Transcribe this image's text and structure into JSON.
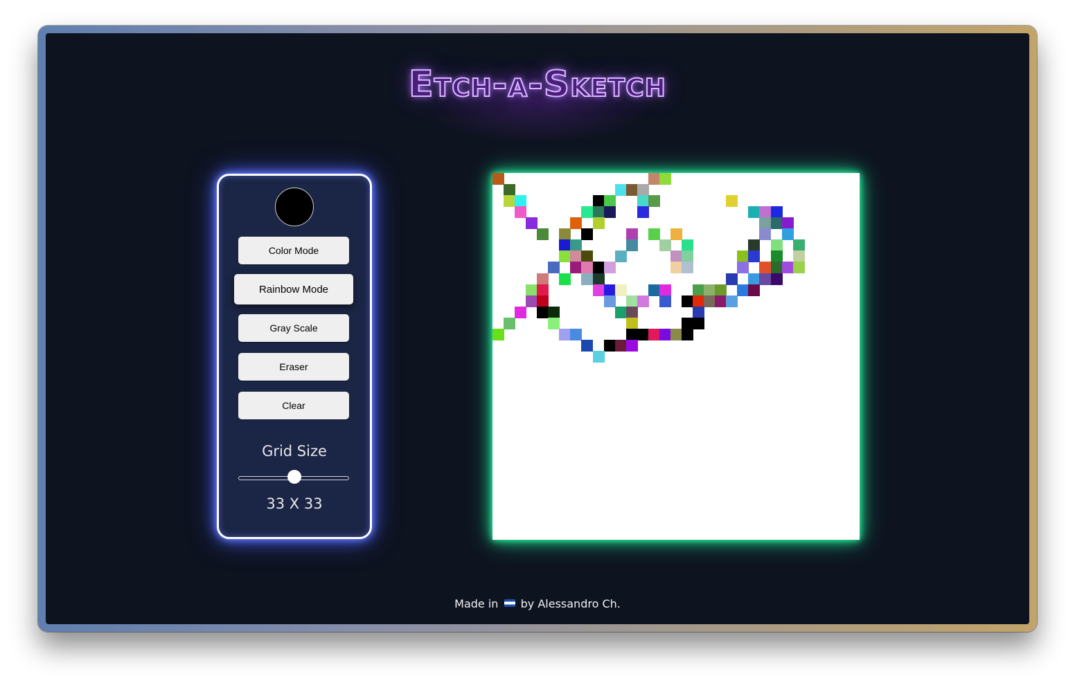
{
  "app": {
    "title": "Etch-a-Sketch",
    "footer": {
      "prefix": "Made in",
      "flag": "el-salvador-flag",
      "suffix": "by Alessandro Ch."
    }
  },
  "controls": {
    "current_color": "#000000",
    "buttons": [
      {
        "label": "Color Mode",
        "active": false
      },
      {
        "label": "Rainbow Mode",
        "active": true
      },
      {
        "label": "Gray Scale",
        "active": false
      },
      {
        "label": "Eraser",
        "active": false
      },
      {
        "label": "Clear",
        "active": false
      }
    ],
    "grid_size_label": "Grid Size",
    "grid_size": 33,
    "grid_size_min": 1,
    "grid_size_max": 64,
    "grid_size_display": "33 X 33"
  },
  "canvas": {
    "columns": 33,
    "rows": 33,
    "background": "#ffffff",
    "painted_cells": [
      {
        "c": 0,
        "r": 0,
        "color": "#b85a1a"
      },
      {
        "c": 14,
        "r": 0,
        "color": "#c4856a"
      },
      {
        "c": 15,
        "r": 0,
        "color": "#8edb3a"
      },
      {
        "c": 1,
        "r": 1,
        "color": "#3c6a2a"
      },
      {
        "c": 11,
        "r": 1,
        "color": "#4ee0ea"
      },
      {
        "c": 12,
        "r": 1,
        "color": "#7a5a30"
      },
      {
        "c": 13,
        "r": 1,
        "color": "#a9a9a9"
      },
      {
        "c": 1,
        "r": 2,
        "color": "#b8d63a"
      },
      {
        "c": 2,
        "r": 2,
        "color": "#2ef0f0"
      },
      {
        "c": 9,
        "r": 2,
        "color": "#000000"
      },
      {
        "c": 10,
        "r": 2,
        "color": "#4ac84a"
      },
      {
        "c": 13,
        "r": 2,
        "color": "#4ad8c8"
      },
      {
        "c": 14,
        "r": 2,
        "color": "#5a9a4a"
      },
      {
        "c": 21,
        "r": 2,
        "color": "#e0d030"
      },
      {
        "c": 2,
        "r": 3,
        "color": "#f05ac8"
      },
      {
        "c": 8,
        "r": 3,
        "color": "#2ae890"
      },
      {
        "c": 9,
        "r": 3,
        "color": "#2a7a5a"
      },
      {
        "c": 10,
        "r": 3,
        "color": "#1a1a5a"
      },
      {
        "c": 13,
        "r": 3,
        "color": "#2a2ae0"
      },
      {
        "c": 23,
        "r": 3,
        "color": "#1ab0b0"
      },
      {
        "c": 24,
        "r": 3,
        "color": "#c070d0"
      },
      {
        "c": 25,
        "r": 3,
        "color": "#1a2ae0"
      },
      {
        "c": 3,
        "r": 4,
        "color": "#8a2ae0"
      },
      {
        "c": 7,
        "r": 4,
        "color": "#e0600a"
      },
      {
        "c": 9,
        "r": 4,
        "color": "#b0d030"
      },
      {
        "c": 24,
        "r": 4,
        "color": "#7aa0a0"
      },
      {
        "c": 25,
        "r": 4,
        "color": "#2a6a6a"
      },
      {
        "c": 26,
        "r": 4,
        "color": "#8a1ad0"
      },
      {
        "c": 4,
        "r": 5,
        "color": "#4a8a3a"
      },
      {
        "c": 6,
        "r": 5,
        "color": "#8a8a3a"
      },
      {
        "c": 8,
        "r": 5,
        "color": "#000000"
      },
      {
        "c": 12,
        "r": 5,
        "color": "#b040b0"
      },
      {
        "c": 14,
        "r": 5,
        "color": "#5ad04a"
      },
      {
        "c": 16,
        "r": 5,
        "color": "#f0b040"
      },
      {
        "c": 24,
        "r": 5,
        "color": "#8a8ad0"
      },
      {
        "c": 26,
        "r": 5,
        "color": "#30a0e0"
      },
      {
        "c": 6,
        "r": 6,
        "color": "#1a1ad0"
      },
      {
        "c": 7,
        "r": 6,
        "color": "#3a9a8a"
      },
      {
        "c": 12,
        "r": 6,
        "color": "#4a8aa0"
      },
      {
        "c": 15,
        "r": 6,
        "color": "#a0d0a0"
      },
      {
        "c": 17,
        "r": 6,
        "color": "#2ae08a"
      },
      {
        "c": 23,
        "r": 6,
        "color": "#2a3a2a"
      },
      {
        "c": 25,
        "r": 6,
        "color": "#80e080"
      },
      {
        "c": 27,
        "r": 6,
        "color": "#3ab070"
      },
      {
        "c": 6,
        "r": 7,
        "color": "#8ae03a"
      },
      {
        "c": 7,
        "r": 7,
        "color": "#d08a9a"
      },
      {
        "c": 8,
        "r": 7,
        "color": "#4a4a0a"
      },
      {
        "c": 11,
        "r": 7,
        "color": "#5ab0c0"
      },
      {
        "c": 16,
        "r": 7,
        "color": "#c090c0"
      },
      {
        "c": 17,
        "r": 7,
        "color": "#80d0a0"
      },
      {
        "c": 22,
        "r": 7,
        "color": "#8ac01a"
      },
      {
        "c": 23,
        "r": 7,
        "color": "#2a3ad0"
      },
      {
        "c": 25,
        "r": 7,
        "color": "#1a8a2a"
      },
      {
        "c": 27,
        "r": 7,
        "color": "#c0d0a0"
      },
      {
        "c": 5,
        "r": 8,
        "color": "#4a6ac0"
      },
      {
        "c": 7,
        "r": 8,
        "color": "#9a1a7a"
      },
      {
        "c": 8,
        "r": 8,
        "color": "#e07ab0"
      },
      {
        "c": 9,
        "r": 8,
        "color": "#000000"
      },
      {
        "c": 10,
        "r": 8,
        "color": "#d0a0e0"
      },
      {
        "c": 16,
        "r": 8,
        "color": "#f0d0a0"
      },
      {
        "c": 17,
        "r": 8,
        "color": "#b0c0d0"
      },
      {
        "c": 22,
        "r": 8,
        "color": "#8a70e0"
      },
      {
        "c": 24,
        "r": 8,
        "color": "#e0502a"
      },
      {
        "c": 25,
        "r": 8,
        "color": "#2a6a2a"
      },
      {
        "c": 26,
        "r": 8,
        "color": "#a04ae0"
      },
      {
        "c": 27,
        "r": 8,
        "color": "#9ad04a"
      },
      {
        "c": 4,
        "r": 9,
        "color": "#d07a7a"
      },
      {
        "c": 6,
        "r": 9,
        "color": "#1ae04a"
      },
      {
        "c": 8,
        "r": 9,
        "color": "#8ab0c0"
      },
      {
        "c": 9,
        "r": 9,
        "color": "#1a3a2a"
      },
      {
        "c": 21,
        "r": 9,
        "color": "#2a3ab0"
      },
      {
        "c": 23,
        "r": 9,
        "color": "#3a9ae0"
      },
      {
        "c": 24,
        "r": 9,
        "color": "#6a4aa0"
      },
      {
        "c": 25,
        "r": 9,
        "color": "#3a0a6a"
      },
      {
        "c": 3,
        "r": 10,
        "color": "#8ae06a"
      },
      {
        "c": 4,
        "r": 10,
        "color": "#e01a4a"
      },
      {
        "c": 9,
        "r": 10,
        "color": "#e040e0"
      },
      {
        "c": 10,
        "r": 10,
        "color": "#2a1ae0"
      },
      {
        "c": 11,
        "r": 10,
        "color": "#f0f0c0"
      },
      {
        "c": 14,
        "r": 10,
        "color": "#1a6aa0"
      },
      {
        "c": 15,
        "r": 10,
        "color": "#e02ae0"
      },
      {
        "c": 18,
        "r": 10,
        "color": "#4aa04a"
      },
      {
        "c": 19,
        "r": 10,
        "color": "#8ab06a"
      },
      {
        "c": 20,
        "r": 10,
        "color": "#6a9a2a"
      },
      {
        "c": 22,
        "r": 10,
        "color": "#2a7ae0"
      },
      {
        "c": 23,
        "r": 10,
        "color": "#6a0a4a"
      },
      {
        "c": 3,
        "r": 11,
        "color": "#9a4ab0"
      },
      {
        "c": 4,
        "r": 11,
        "color": "#c0001a"
      },
      {
        "c": 10,
        "r": 11,
        "color": "#6a9ae0"
      },
      {
        "c": 12,
        "r": 11,
        "color": "#a0e0a0"
      },
      {
        "c": 13,
        "r": 11,
        "color": "#d07ae0"
      },
      {
        "c": 15,
        "r": 11,
        "color": "#3a5ad0"
      },
      {
        "c": 17,
        "r": 11,
        "color": "#000000"
      },
      {
        "c": 18,
        "r": 11,
        "color": "#e02a0a"
      },
      {
        "c": 19,
        "r": 11,
        "color": "#7a6a5a"
      },
      {
        "c": 20,
        "r": 11,
        "color": "#8a1a6a"
      },
      {
        "c": 21,
        "r": 11,
        "color": "#5aa0e0"
      },
      {
        "c": 2,
        "r": 12,
        "color": "#e02ae0"
      },
      {
        "c": 4,
        "r": 12,
        "color": "#000000"
      },
      {
        "c": 5,
        "r": 12,
        "color": "#0a2a0a"
      },
      {
        "c": 11,
        "r": 12,
        "color": "#1aa06a"
      },
      {
        "c": 12,
        "r": 12,
        "color": "#6a4a5a"
      },
      {
        "c": 18,
        "r": 12,
        "color": "#2a3ab0"
      },
      {
        "c": 1,
        "r": 13,
        "color": "#6ac06a"
      },
      {
        "c": 5,
        "r": 13,
        "color": "#8af07a"
      },
      {
        "c": 12,
        "r": 13,
        "color": "#c0c01a"
      },
      {
        "c": 17,
        "r": 13,
        "color": "#000000"
      },
      {
        "c": 18,
        "r": 13,
        "color": "#000000"
      },
      {
        "c": 0,
        "r": 14,
        "color": "#6ae01a"
      },
      {
        "c": 6,
        "r": 14,
        "color": "#a0a0f0"
      },
      {
        "c": 7,
        "r": 14,
        "color": "#4a8ae0"
      },
      {
        "c": 12,
        "r": 14,
        "color": "#000000"
      },
      {
        "c": 13,
        "r": 14,
        "color": "#000000"
      },
      {
        "c": 14,
        "r": 14,
        "color": "#e01a5a"
      },
      {
        "c": 15,
        "r": 14,
        "color": "#7a0ae0"
      },
      {
        "c": 16,
        "r": 14,
        "color": "#8a8a4a"
      },
      {
        "c": 17,
        "r": 14,
        "color": "#000000"
      },
      {
        "c": 8,
        "r": 15,
        "color": "#1a4ab0"
      },
      {
        "c": 10,
        "r": 15,
        "color": "#000000"
      },
      {
        "c": 11,
        "r": 15,
        "color": "#6a1a3a"
      },
      {
        "c": 12,
        "r": 15,
        "color": "#9a0ae0"
      },
      {
        "c": 9,
        "r": 16,
        "color": "#5ad0e0"
      }
    ]
  },
  "colors": {
    "background": "#0e1320",
    "panel": "#1b2545",
    "panel_glow": "#4c63ff",
    "canvas_glow": "#1fd990",
    "title": "#4a1f7c",
    "title_glow": "#b078ff"
  }
}
